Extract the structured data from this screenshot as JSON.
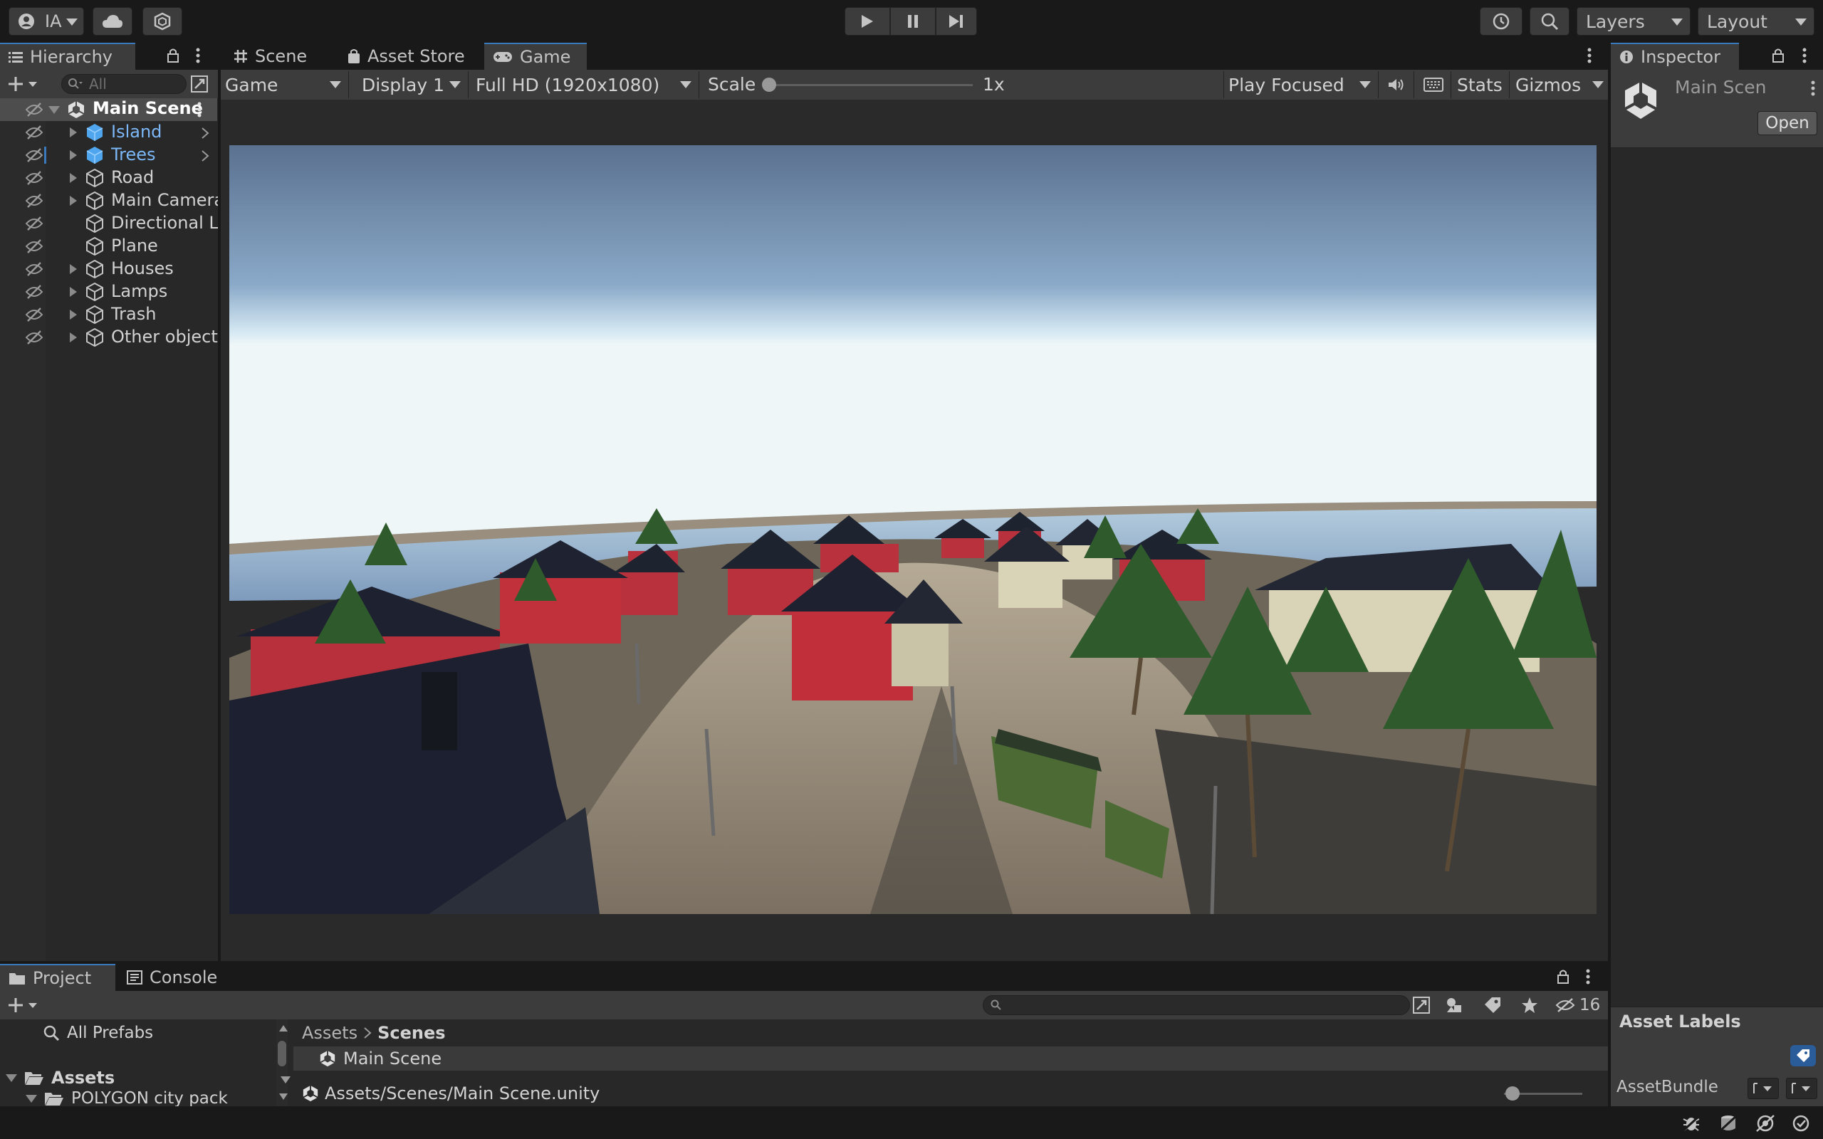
{
  "toolbar": {
    "account_label": "IA",
    "layers_label": "Layers",
    "layout_label": "Layout"
  },
  "hierarchy": {
    "tab_label": "Hierarchy",
    "search_placeholder": "All",
    "scene_name": "Main Scene",
    "items": [
      {
        "label": "Island",
        "prefab": true,
        "expandable": true
      },
      {
        "label": "Trees",
        "prefab": true,
        "expandable": true
      },
      {
        "label": "Road",
        "prefab": false,
        "expandable": true
      },
      {
        "label": "Main Camera",
        "prefab": false,
        "expandable": true
      },
      {
        "label": "Directional Li",
        "prefab": false,
        "expandable": false
      },
      {
        "label": "Plane",
        "prefab": false,
        "expandable": false
      },
      {
        "label": "Houses",
        "prefab": false,
        "expandable": true
      },
      {
        "label": "Lamps",
        "prefab": false,
        "expandable": true
      },
      {
        "label": "Trash",
        "prefab": false,
        "expandable": true
      },
      {
        "label": "Other objects",
        "prefab": false,
        "expandable": true
      }
    ]
  },
  "center_tabs": [
    {
      "label": "Scene",
      "icon": "grid-icon"
    },
    {
      "label": "Asset Store",
      "icon": "bag-icon"
    },
    {
      "label": "Game",
      "icon": "gamepad-icon"
    }
  ],
  "game_toolbar": {
    "view_mode": "Game",
    "display": "Display 1",
    "resolution": "Full HD (1920x1080)",
    "scale_label": "Scale",
    "scale_value": "1x",
    "play_mode": "Play Focused",
    "stats_label": "Stats",
    "gizmos_label": "Gizmos"
  },
  "inspector": {
    "tab_label": "Inspector",
    "object_name": "Main Scen",
    "open_label": "Open",
    "asset_labels_title": "Asset Labels",
    "asset_bundle_label": "AssetBundle"
  },
  "project": {
    "tabs": [
      {
        "label": "Project",
        "icon": "folder-icon"
      },
      {
        "label": "Console",
        "icon": "console-icon"
      }
    ],
    "hidden_count": "16",
    "favorites": "All Prefabs",
    "tree": [
      {
        "label": "Assets",
        "bold": true
      },
      {
        "label": "POLYGON city pack",
        "bold": false
      }
    ],
    "breadcrumb": [
      "Assets",
      "Scenes"
    ],
    "files": [
      "Main Scene"
    ],
    "selected_path": "Assets/Scenes/Main Scene.unity"
  },
  "colors": {
    "accent": "#3a79bb",
    "prefab_blue": "#7cb8f7",
    "panel_bg": "#282828",
    "toolbar_bg": "#191919"
  }
}
